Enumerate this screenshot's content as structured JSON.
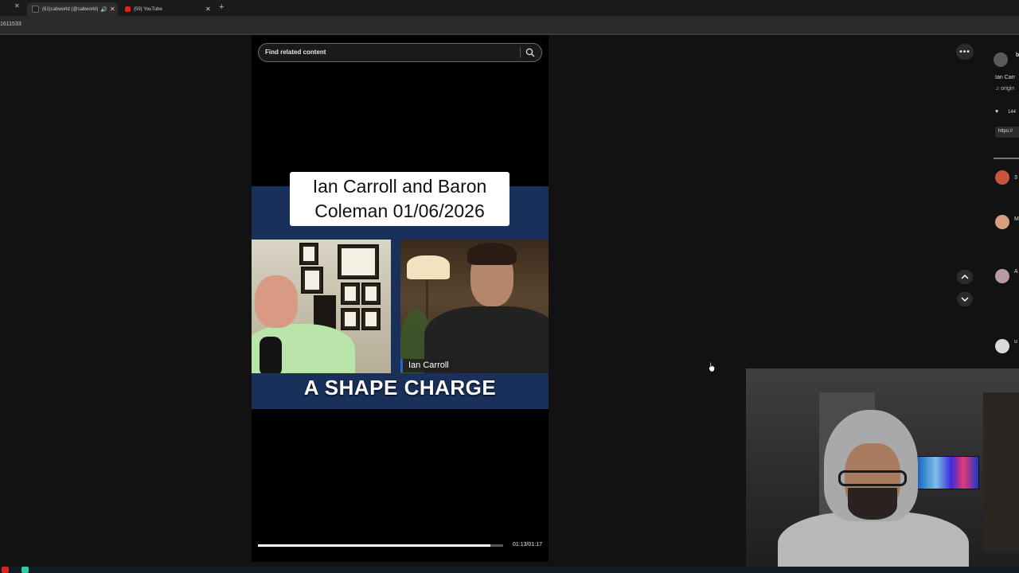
{
  "browser": {
    "tabs": [
      {
        "label": "(61)cabworld (@cabworld)",
        "active": true
      },
      {
        "label": "(59) YouTube",
        "active": false
      }
    ],
    "address_text": "1611533"
  },
  "search": {
    "placeholder": "Find related content"
  },
  "video": {
    "title_line1": "Ian Carroll and Baron",
    "title_line2": "Coleman 01/06/2026",
    "name_tag": "Ian Carroll",
    "caption": "A SHAPE CHARGE",
    "time": "01:13/01:17",
    "progress": 0.948
  },
  "controls": {
    "more_label": "•••"
  },
  "sidebar": {
    "author_initial": "b",
    "desc": "Ian Carr",
    "music": "♫ origin",
    "likes": "144",
    "link": "https://",
    "comments": [
      {
        "line": "3"
      },
      {
        "line": "M"
      },
      {
        "line": "A"
      },
      {
        "line": "u"
      }
    ]
  },
  "colors": {
    "band": "#19305a",
    "name_tag_accent": "#2a62c9",
    "page_bg": "#121212"
  }
}
